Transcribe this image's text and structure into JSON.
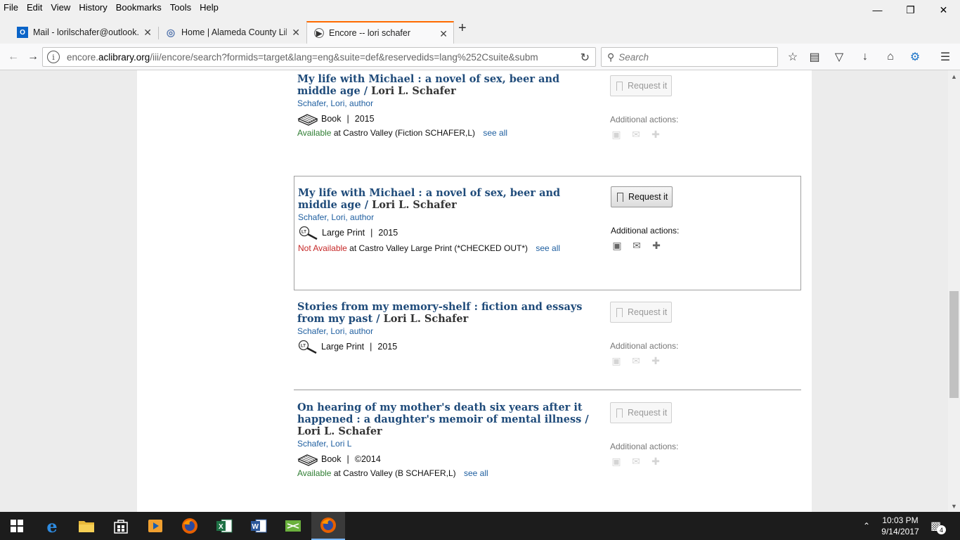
{
  "menu": [
    "File",
    "Edit",
    "View",
    "History",
    "Bookmarks",
    "Tools",
    "Help"
  ],
  "tabs": [
    {
      "label": "Mail - lorilschafer@outlook.",
      "icon": "outlook-icon"
    },
    {
      "label": "Home | Alameda County Lib",
      "icon": "library-icon"
    },
    {
      "label": "Encore -- lori schafer",
      "icon": "play-icon"
    }
  ],
  "urlbar": {
    "prefix": "encore.",
    "host": "aclibrary.org",
    "path": "/iii/encore/search?formids=target&lang=eng&suite=def&reservedids=lang%252Csuite&subm"
  },
  "search": {
    "placeholder": "Search"
  },
  "records": [
    {
      "title": "My life with Michael : a novel of sex, beer and middle age /",
      "author_statement": "Lori L. Schafer",
      "author": "Schafer, Lori, author",
      "format": "Book",
      "year": "2015",
      "availability": "Available",
      "location": "at Castro Valley (Fiction SCHAFER,L)",
      "see_all": "see all",
      "request": "Request it",
      "actions_label": "Additional actions:"
    },
    {
      "title": "My life with Michael : a novel of sex, beer and middle age /",
      "author_statement": "Lori L. Schafer",
      "author": "Schafer, Lori, author",
      "format": "Large Print",
      "year": "2015",
      "availability": "Not Available",
      "location": "at Castro Valley Large Print (*CHECKED OUT*)",
      "see_all": "see all",
      "request": "Request it",
      "actions_label": "Additional actions:"
    },
    {
      "title": "Stories from my memory-shelf : fiction and essays from my past /",
      "author_statement": "Lori L. Schafer",
      "author": "Schafer, Lori, author",
      "format": "Large Print",
      "year": "2015",
      "request": "Request it",
      "actions_label": "Additional actions:"
    },
    {
      "title": "On hearing of my mother's death six years after it happened : a daughter's memoir of mental illness /",
      "author_statement": "Lori L. Schafer",
      "author": "Schafer, Lori L",
      "format": "Book",
      "year": "©2014",
      "availability": "Available",
      "location": "at Castro Valley (B SCHAFER,L)",
      "see_all": "see all",
      "request": "Request it",
      "actions_label": "Additional actions:"
    }
  ],
  "taskbar": {
    "time": "10:03 PM",
    "date": "9/14/2017",
    "notifications": "4"
  }
}
